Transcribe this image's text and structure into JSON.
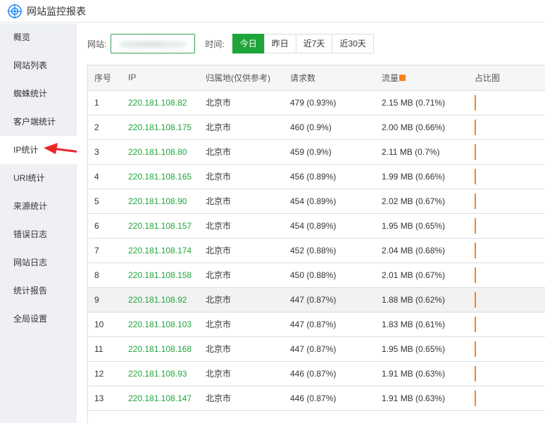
{
  "app": {
    "title": "网站监控报表"
  },
  "sidebar": {
    "items": [
      {
        "label": "概览"
      },
      {
        "label": "网站列表"
      },
      {
        "label": "蜘蛛统计"
      },
      {
        "label": "客户端统计"
      },
      {
        "label": "IP统计",
        "active": true
      },
      {
        "label": "URI统计"
      },
      {
        "label": "来源统计"
      },
      {
        "label": "错误日志"
      },
      {
        "label": "网站日志"
      },
      {
        "label": "统计报告"
      },
      {
        "label": "全局设置"
      }
    ]
  },
  "toolbar": {
    "site_label": "网站:",
    "time_label": "时间:",
    "ranges": [
      "今日",
      "昨日",
      "近7天",
      "近30天"
    ],
    "active_range": "今日"
  },
  "table": {
    "headers": [
      "序号",
      "IP",
      "归属地(仅供参考)",
      "请求数",
      "流量",
      "占比图"
    ],
    "rows": [
      [
        "1",
        "220.181.108.82",
        "北京市",
        "479 (0.93%)",
        "2.15 MB (0.71%)"
      ],
      [
        "2",
        "220.181.108.175",
        "北京市",
        "460 (0.9%)",
        "2.00 MB (0.66%)"
      ],
      [
        "3",
        "220.181.108.80",
        "北京市",
        "459 (0.9%)",
        "2.11 MB (0.7%)"
      ],
      [
        "4",
        "220.181.108.165",
        "北京市",
        "456 (0.89%)",
        "1.99 MB (0.66%)"
      ],
      [
        "5",
        "220.181.108.90",
        "北京市",
        "454 (0.89%)",
        "2.02 MB (0.67%)"
      ],
      [
        "6",
        "220.181.108.157",
        "北京市",
        "454 (0.89%)",
        "1.95 MB (0.65%)"
      ],
      [
        "7",
        "220.181.108.174",
        "北京市",
        "452 (0.88%)",
        "2.04 MB (0.68%)"
      ],
      [
        "8",
        "220.181.108.158",
        "北京市",
        "450 (0.88%)",
        "2.01 MB (0.67%)"
      ],
      [
        "9",
        "220.181.108.92",
        "北京市",
        "447 (0.87%)",
        "1.88 MB (0.62%)"
      ],
      [
        "10",
        "220.181.108.103",
        "北京市",
        "447 (0.87%)",
        "1.83 MB (0.61%)"
      ],
      [
        "11",
        "220.181.108.168",
        "北京市",
        "447 (0.87%)",
        "1.95 MB (0.65%)"
      ],
      [
        "12",
        "220.181.108.93",
        "北京市",
        "446 (0.87%)",
        "1.91 MB (0.63%)"
      ],
      [
        "13",
        "220.181.108.147",
        "北京市",
        "446 (0.87%)",
        "1.91 MB (0.63%)"
      ]
    ],
    "hover_row_index": 8
  },
  "colors": {
    "accent": "#20a53a",
    "bar": "#f7821f",
    "arrow": "#e8262c"
  },
  "icons": {
    "logo": "target-logo-icon",
    "sort": "sort-icon",
    "annotation": "red-arrow-icon"
  }
}
